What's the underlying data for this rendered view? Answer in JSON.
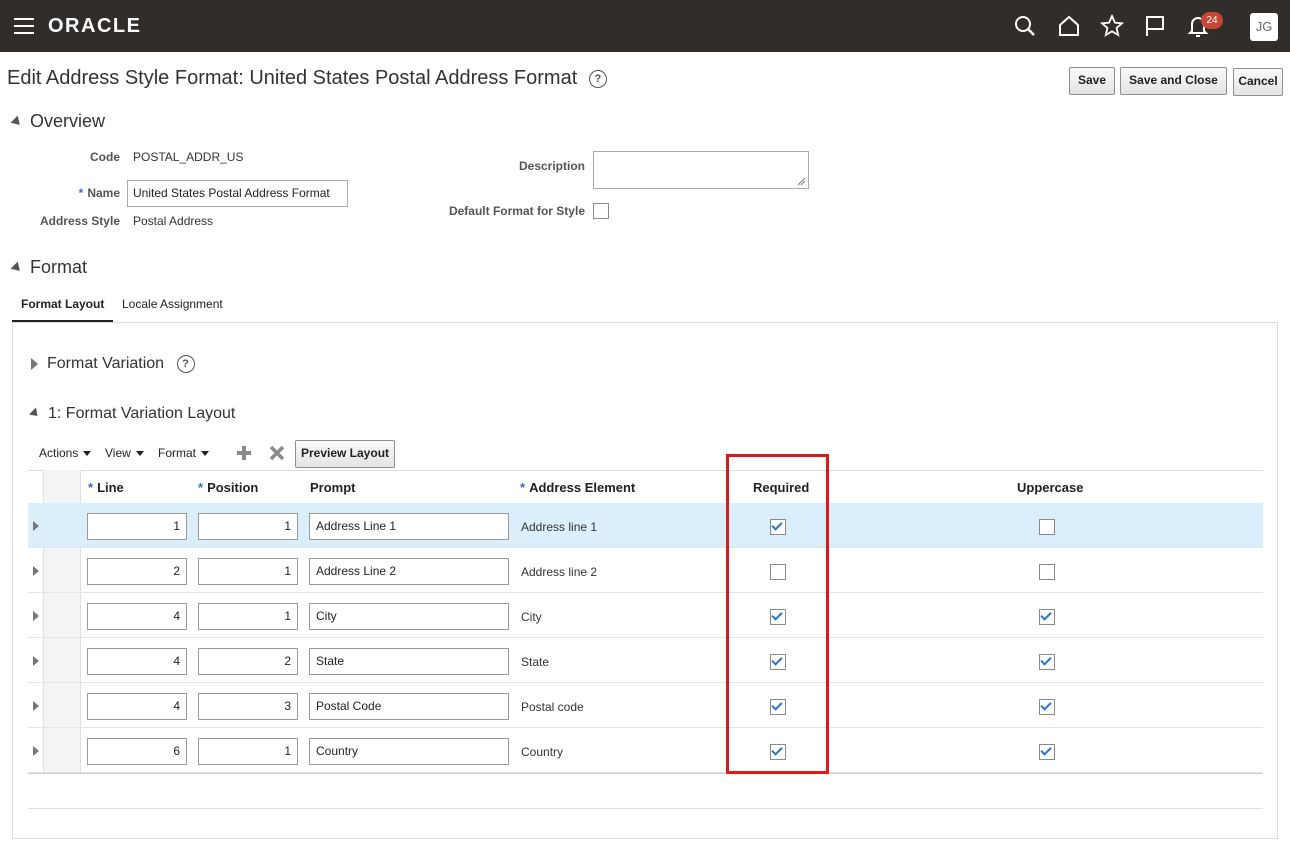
{
  "header": {
    "brand": "ORACLE",
    "notification_count": "24",
    "user_initials": "JG",
    "icons": [
      "menu-icon",
      "search-icon",
      "home-icon",
      "star-icon",
      "flag-icon",
      "bell-icon"
    ]
  },
  "page": {
    "title": "Edit Address Style Format: United States Postal Address Format",
    "help_glyph": "?",
    "buttons": {
      "save": "Save",
      "save_close": "Save and Close",
      "cancel": "Cancel"
    }
  },
  "overview": {
    "heading": "Overview",
    "code_label": "Code",
    "code_value": "POSTAL_ADDR_US",
    "name_label": "Name",
    "name_value": "United States Postal Address Format",
    "address_style_label": "Address Style",
    "address_style_value": "Postal Address",
    "description_label": "Description",
    "description_value": "",
    "default_format_label": "Default Format for Style",
    "default_format_checked": false
  },
  "format": {
    "heading": "Format",
    "tabs": [
      "Format Layout",
      "Locale Assignment"
    ],
    "variation_heading": "Format Variation",
    "layout_heading": "1: Format Variation Layout",
    "toolbar": {
      "actions": "Actions",
      "view": "View",
      "format": "Format",
      "preview": "Preview Layout"
    },
    "columns": {
      "line": "Line",
      "position": "Position",
      "prompt": "Prompt",
      "address_element": "Address Element",
      "required": "Required",
      "uppercase": "Uppercase"
    },
    "rows": [
      {
        "line": "1",
        "position": "1",
        "prompt": "Address Line 1",
        "element": "Address line 1",
        "required": true,
        "uppercase": false
      },
      {
        "line": "2",
        "position": "1",
        "prompt": "Address Line 2",
        "element": "Address line 2",
        "required": false,
        "uppercase": false
      },
      {
        "line": "4",
        "position": "1",
        "prompt": "City",
        "element": "City",
        "required": true,
        "uppercase": true
      },
      {
        "line": "4",
        "position": "2",
        "prompt": "State",
        "element": "State",
        "required": true,
        "uppercase": true
      },
      {
        "line": "4",
        "position": "3",
        "prompt": "Postal Code",
        "element": "Postal code",
        "required": true,
        "uppercase": true
      },
      {
        "line": "6",
        "position": "1",
        "prompt": "Country",
        "element": "Country",
        "required": true,
        "uppercase": true
      }
    ]
  },
  "colors": {
    "header_bg": "#312d2a",
    "accent": "#2a76c6",
    "badge": "#c74634",
    "highlight": "#e01818",
    "selected_row": "#dbeefb"
  }
}
